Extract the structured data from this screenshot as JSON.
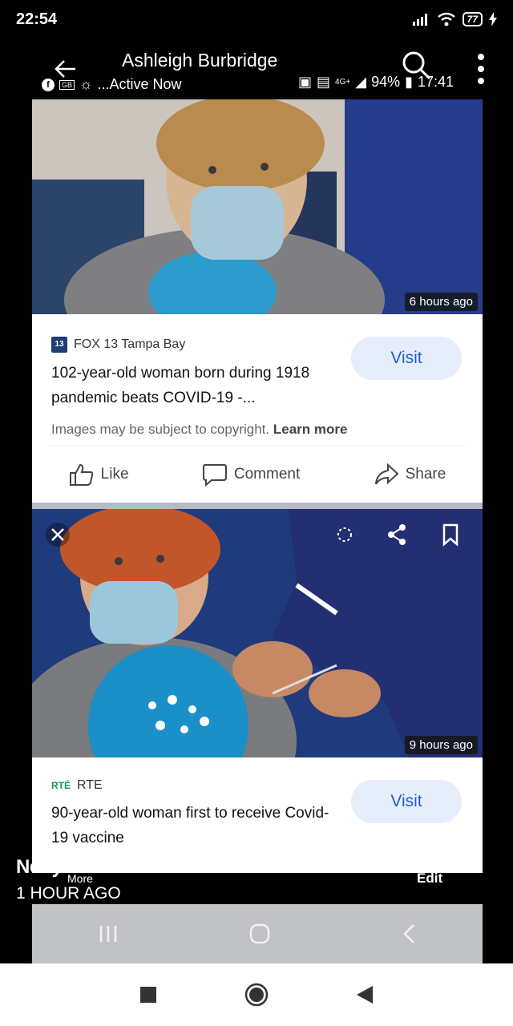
{
  "status_bar": {
    "time": "22:54",
    "battery": "77"
  },
  "chat_header": {
    "name": "Ashleigh Burbridge",
    "status": "...Active Now",
    "inner_signal": "4G+",
    "inner_battery": "94%",
    "inner_time": "17:41"
  },
  "cards": [
    {
      "time_ago": "6 hours ago",
      "source": "FOX 13 Tampa Bay",
      "source_logo": "13",
      "title": "102-year-old woman born during 1918 pandemic beats COVID-19 -...",
      "visit_label": "Visit",
      "copyright_text": "Images may be subject to copyright.",
      "learn_more": "Learn more",
      "actions": {
        "like": "Like",
        "comment": "Comment",
        "share": "Share"
      }
    },
    {
      "time_ago": "9 hours ago",
      "source": "RTE",
      "source_logo": "RTÉ",
      "title": "90-year-old woman first to receive Covid-19 vaccine",
      "visit_label": "Visit"
    }
  ],
  "overlay": {
    "name": "Netty O'Brien",
    "time_ago": "1 HOUR AGO",
    "more": "More",
    "edit": "Edit"
  },
  "colors": {
    "visit_bg": "#e7eefb",
    "visit_text": "#1a5fc8",
    "rte_green": "#1a9a50"
  }
}
